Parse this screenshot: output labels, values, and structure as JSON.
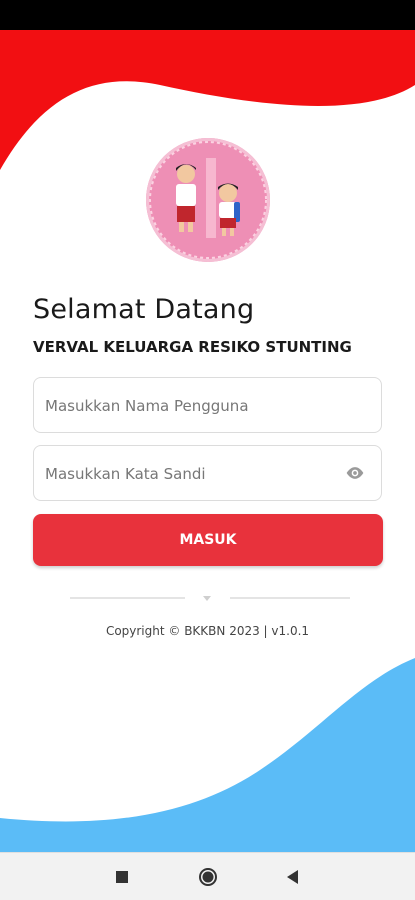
{
  "header": {
    "title": "Selamat Datang",
    "subtitle": "VERVAL KELUARGA RESIKO STUNTING"
  },
  "login": {
    "username_placeholder": "Masukkan Nama Pengguna",
    "password_placeholder": "Masukkan Kata Sandi",
    "submit_label": "MASUK"
  },
  "footer": {
    "copyright": "Copyright © BKKBN 2023 | v1.0.1"
  },
  "colors": {
    "accent_red": "#e8323c",
    "wave_blue": "#5bbcf7",
    "logo_pink": "#ee8fb5"
  },
  "icons": {
    "password_toggle": "eye-icon",
    "nav_recents": "square-icon",
    "nav_home": "circle-icon",
    "nav_back": "triangle-back-icon"
  }
}
